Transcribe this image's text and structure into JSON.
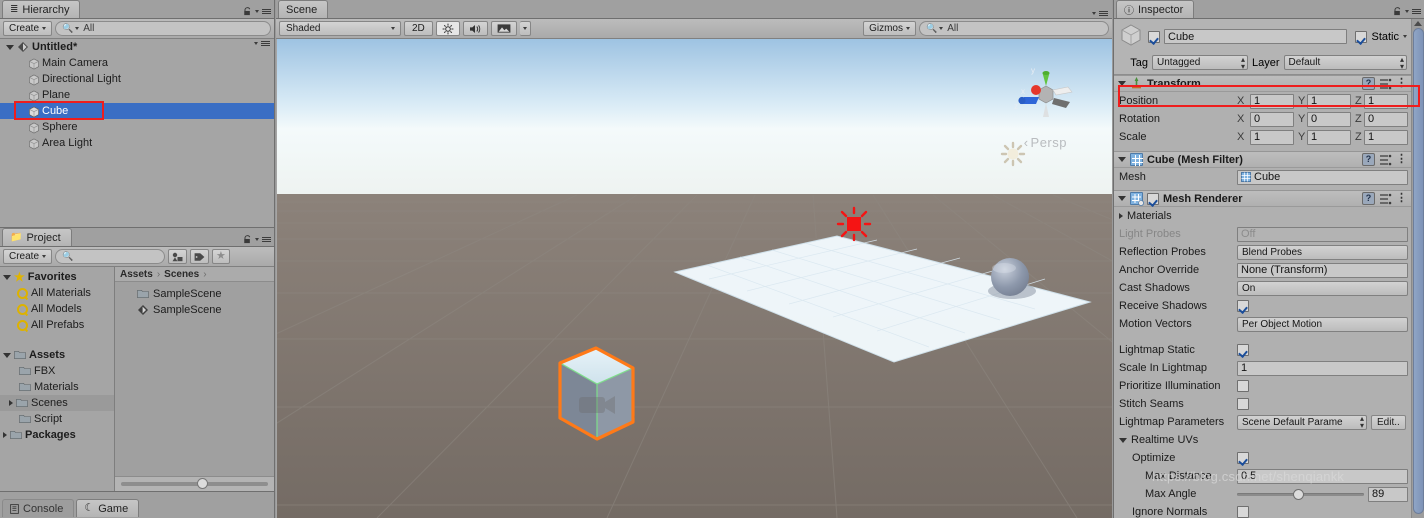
{
  "hierarchy": {
    "tab_label": "Hierarchy",
    "create_label": "Create",
    "search_placeholder": "All",
    "scene_name": "Untitled*",
    "items": [
      {
        "label": "Main Camera"
      },
      {
        "label": "Directional Light"
      },
      {
        "label": "Plane"
      },
      {
        "label": "Cube"
      },
      {
        "label": "Sphere"
      },
      {
        "label": "Area Light"
      }
    ],
    "selected_index": 3
  },
  "project": {
    "tab_label": "Project",
    "create_label": "Create",
    "search_placeholder": "",
    "breadcrumbs": [
      "Assets",
      "Scenes"
    ],
    "favorites_label": "Favorites",
    "favorites": [
      "All Materials",
      "All Models",
      "All Prefabs"
    ],
    "assets_label": "Assets",
    "assets": [
      "FBX",
      "Materials",
      "Scenes",
      "Script"
    ],
    "assets_selected": "Scenes",
    "packages_label": "Packages",
    "contents": [
      {
        "label": "SampleScene",
        "icon": "folder-icon"
      },
      {
        "label": "SampleScene",
        "icon": "unity-scene-icon"
      }
    ]
  },
  "bottom_tabs": [
    {
      "label": "Console",
      "active": false
    },
    {
      "label": "Game",
      "active": true
    }
  ],
  "scene": {
    "tab_label": "Scene",
    "draw_mode": "Shaded",
    "toggle_2d": "2D",
    "gizmos_label": "Gizmos",
    "search_placeholder": "All",
    "camera_mode": "Persp",
    "gizmo_axes": {
      "x": "x",
      "y": "y",
      "z": "z"
    }
  },
  "inspector": {
    "tab_label": "Inspector",
    "object_name": "Cube",
    "object_enabled": true,
    "static_label": "Static",
    "static_checked": true,
    "tag_label": "Tag",
    "tag_value": "Untagged",
    "layer_label": "Layer",
    "layer_value": "Default",
    "transform": {
      "title": "Transform",
      "rows": [
        {
          "label": "Position",
          "x": "1",
          "y": "1",
          "z": "1"
        },
        {
          "label": "Rotation",
          "x": "0",
          "y": "0",
          "z": "0"
        },
        {
          "label": "Scale",
          "x": "1",
          "y": "1",
          "z": "1"
        }
      ],
      "highlight_row": 0,
      "highlight_color": "#ef1d1d"
    },
    "mesh_filter": {
      "title": "Cube (Mesh Filter)",
      "mesh_label": "Mesh",
      "mesh_value": "Cube"
    },
    "mesh_renderer": {
      "title": "Mesh Renderer",
      "enabled": true,
      "materials_label": "Materials",
      "fields": [
        {
          "label": "Light Probes",
          "value": "Off",
          "type": "popup",
          "dim": true
        },
        {
          "label": "Reflection Probes",
          "value": "Blend Probes",
          "type": "popup",
          "dim": false
        },
        {
          "label": "Anchor Override",
          "value": "None (Transform)",
          "type": "object",
          "dim": false
        },
        {
          "label": "Cast Shadows",
          "value": "On",
          "type": "popup",
          "dim": false
        },
        {
          "label": "Receive Shadows",
          "value": true,
          "type": "check",
          "dim": false
        },
        {
          "label": "Motion Vectors",
          "value": "Per Object Motion",
          "type": "popup",
          "dim": false
        }
      ],
      "lightmap": [
        {
          "label": "Lightmap Static",
          "value": true,
          "type": "check"
        },
        {
          "label": "Scale In Lightmap",
          "value": "1",
          "type": "text"
        },
        {
          "label": "Prioritize Illumination",
          "value": false,
          "type": "check"
        },
        {
          "label": "Stitch Seams",
          "value": false,
          "type": "check"
        }
      ],
      "lightmap_parameters": {
        "label": "Lightmap Parameters",
        "value": "Scene Default Parame",
        "edit_label": "Edit.."
      },
      "realtime_uvs": {
        "label": "Realtime UVs",
        "rows": [
          {
            "label": "Optimize",
            "value": true,
            "type": "check"
          },
          {
            "label": "Max Distance",
            "value": "0.5",
            "type": "text"
          },
          {
            "label": "Max Angle",
            "value": "89",
            "type": "slider"
          },
          {
            "label": "Ignore Normals",
            "value": false,
            "type": "check"
          }
        ]
      }
    }
  },
  "watermark": "https://blog.csdn.net/shenqiankk",
  "colors": {
    "selection_blue": "#3a6ec4",
    "highlight_red": "#ef1d1d",
    "panel_bg": "#a5a5a5",
    "inspector_bg": "#b0b0b0"
  }
}
